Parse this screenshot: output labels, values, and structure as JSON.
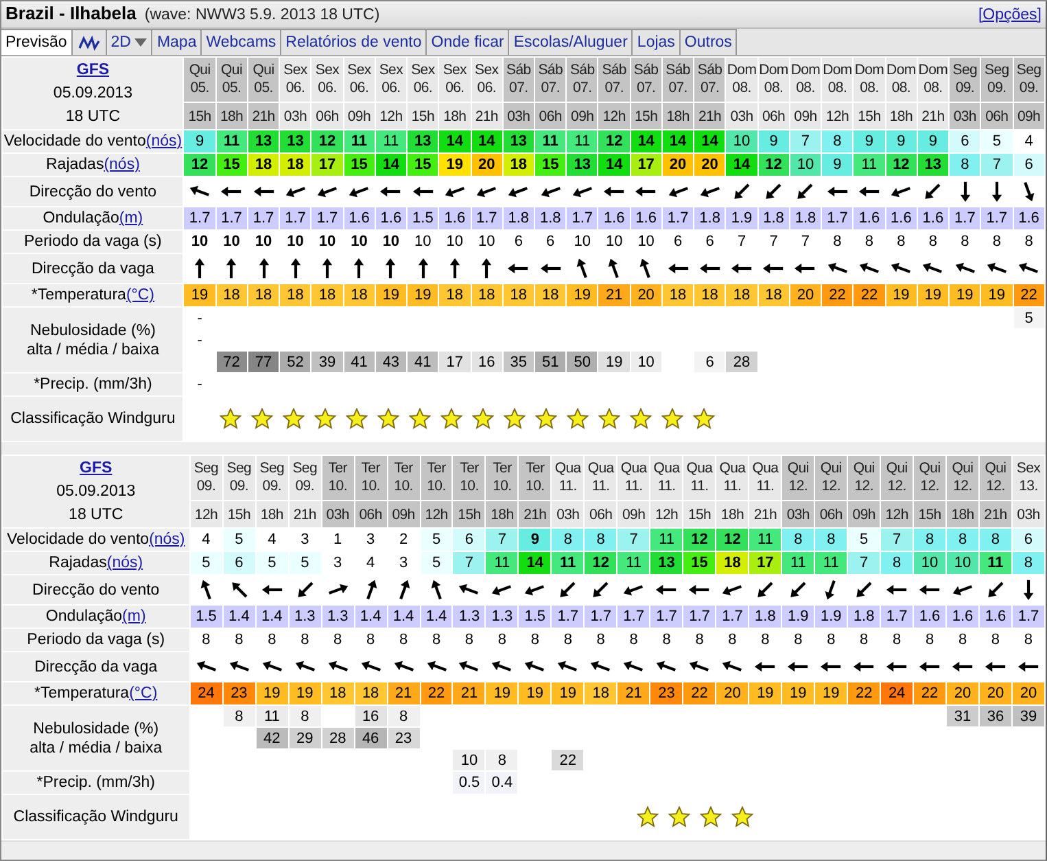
{
  "title": "Brazil - Ilhabela",
  "subtitle": "(wave: NWW3 5.9. 2013 18 UTC)",
  "options_link": "[Opções]",
  "tabs": [
    {
      "kind": "text",
      "label": "Previsão",
      "selected": true
    },
    {
      "kind": "chart",
      "selected": false
    },
    {
      "kind": "dropdown",
      "label": "2D",
      "selected": false
    },
    {
      "kind": "text",
      "label": "Mapa",
      "selected": false
    },
    {
      "kind": "text",
      "label": "Webcams",
      "selected": false
    },
    {
      "kind": "text",
      "label": "Relatórios de vento",
      "selected": false
    },
    {
      "kind": "text",
      "label": "Onde ficar",
      "selected": false
    },
    {
      "kind": "text",
      "label": "Escolas/Aluguer",
      "selected": false
    },
    {
      "kind": "text",
      "label": "Lojas",
      "selected": false
    },
    {
      "kind": "text",
      "label": "Outros",
      "selected": false
    }
  ],
  "forecasts": [
    {
      "model": "GFS",
      "date": "05.09.2013",
      "time": "18 UTC",
      "rows": [
        {
          "kind": "wind_speed",
          "label": "Velocidade do vento",
          "unit": "(nós)"
        },
        {
          "kind": "gusts",
          "label": "Rajadas",
          "unit": "(nós)"
        },
        {
          "kind": "wind_dir",
          "label": "Direcção do vento"
        },
        {
          "kind": "swell",
          "label": "Ondulação",
          "unit": "(m)"
        },
        {
          "kind": "period",
          "label": "Periodo da vaga (s)"
        },
        {
          "kind": "wave_dir",
          "label": "Direcção da vaga"
        },
        {
          "kind": "temperature",
          "label": "*Temperatura",
          "unit": "(°C)"
        },
        {
          "kind": "cloud",
          "label": "Nebulosidade (%)",
          "sublabel": "alta / média / baixa"
        },
        {
          "kind": "precip",
          "label": "*Precip. (mm/3h)"
        },
        {
          "kind": "rating",
          "label": "Classificação Windguru"
        }
      ],
      "columns": [
        {
          "day": "Qui",
          "date": "05.",
          "hour": "15h",
          "shaded": true,
          "wind_speed": {
            "value": "9",
            "bold": false
          },
          "gusts": {
            "value": "12",
            "bold": true
          },
          "wind_dir": {
            "kind": "wnw"
          },
          "swell": "1.7",
          "period": {
            "value": "10",
            "bold": true
          },
          "wave_dir": {
            "kind": "n"
          },
          "temperature": "19",
          "cloud_high": "-",
          "cloud_mid": "-",
          "precip": "-"
        },
        {
          "day": "Qui",
          "date": "05.",
          "hour": "18h",
          "shaded": true,
          "wind_speed": {
            "value": "11",
            "bold": true
          },
          "gusts": {
            "value": "15",
            "bold": true
          },
          "wind_dir": {
            "kind": "w"
          },
          "swell": "1.7",
          "period": {
            "value": "10",
            "bold": true
          },
          "wave_dir": {
            "kind": "n"
          },
          "temperature": "18",
          "cloud_low": "72",
          "rated": true
        },
        {
          "day": "Qui",
          "date": "05.",
          "hour": "21h",
          "shaded": true,
          "wind_speed": {
            "value": "13",
            "bold": true
          },
          "gusts": {
            "value": "18",
            "bold": true
          },
          "wind_dir": {
            "kind": "w"
          },
          "swell": "1.7",
          "period": {
            "value": "10",
            "bold": true
          },
          "wave_dir": {
            "kind": "n"
          },
          "temperature": "18",
          "cloud_low": "77",
          "rated": true
        },
        {
          "day": "Sex",
          "date": "06.",
          "hour": "03h",
          "shaded": false,
          "wind_speed": {
            "value": "13",
            "bold": true
          },
          "gusts": {
            "value": "18",
            "bold": true
          },
          "wind_dir": {
            "kind": "wsw"
          },
          "swell": "1.7",
          "period": {
            "value": "10",
            "bold": true
          },
          "wave_dir": {
            "kind": "n"
          },
          "temperature": "18",
          "cloud_low": "52",
          "rated": true
        },
        {
          "day": "Sex",
          "date": "06.",
          "hour": "06h",
          "shaded": false,
          "wind_speed": {
            "value": "12",
            "bold": true
          },
          "gusts": {
            "value": "17",
            "bold": true
          },
          "wind_dir": {
            "kind": "wsw"
          },
          "swell": "1.7",
          "period": {
            "value": "10",
            "bold": true
          },
          "wave_dir": {
            "kind": "n"
          },
          "temperature": "18",
          "cloud_low": "39",
          "rated": true
        },
        {
          "day": "Sex",
          "date": "06.",
          "hour": "09h",
          "shaded": false,
          "wind_speed": {
            "value": "11",
            "bold": true
          },
          "gusts": {
            "value": "15",
            "bold": true
          },
          "wind_dir": {
            "kind": "wsw"
          },
          "swell": "1.6",
          "period": {
            "value": "10",
            "bold": true
          },
          "wave_dir": {
            "kind": "n"
          },
          "temperature": "18",
          "cloud_low": "41",
          "rated": true
        },
        {
          "day": "Sex",
          "date": "06.",
          "hour": "12h",
          "shaded": false,
          "wind_speed": {
            "value": "11",
            "bold": false
          },
          "gusts": {
            "value": "14",
            "bold": true
          },
          "wind_dir": {
            "kind": "w"
          },
          "swell": "1.6",
          "period": {
            "value": "10",
            "bold": true
          },
          "wave_dir": {
            "kind": "n"
          },
          "temperature": "19",
          "cloud_low": "43",
          "rated": true
        },
        {
          "day": "Sex",
          "date": "06.",
          "hour": "15h",
          "shaded": false,
          "wind_speed": {
            "value": "13",
            "bold": true
          },
          "gusts": {
            "value": "15",
            "bold": true
          },
          "wind_dir": {
            "kind": "w"
          },
          "swell": "1.5",
          "period": {
            "value": "10",
            "bold": false
          },
          "wave_dir": {
            "kind": "n"
          },
          "temperature": "19",
          "cloud_low": "41",
          "rated": true
        },
        {
          "day": "Sex",
          "date": "06.",
          "hour": "18h",
          "shaded": false,
          "wind_speed": {
            "value": "14",
            "bold": true
          },
          "gusts": {
            "value": "19",
            "bold": true
          },
          "wind_dir": {
            "kind": "wsw"
          },
          "swell": "1.6",
          "period": {
            "value": "10",
            "bold": false
          },
          "wave_dir": {
            "kind": "n"
          },
          "temperature": "18",
          "cloud_low": "17",
          "rated": true
        },
        {
          "day": "Sex",
          "date": "06.",
          "hour": "21h",
          "shaded": false,
          "wind_speed": {
            "value": "14",
            "bold": true
          },
          "gusts": {
            "value": "20",
            "bold": true
          },
          "wind_dir": {
            "kind": "wsw"
          },
          "swell": "1.7",
          "period": {
            "value": "10",
            "bold": false
          },
          "wave_dir": {
            "kind": "n"
          },
          "temperature": "18",
          "cloud_low": "16",
          "rated": true
        },
        {
          "day": "Sáb",
          "date": "07.",
          "hour": "03h",
          "shaded": true,
          "wind_speed": {
            "value": "13",
            "bold": true
          },
          "gusts": {
            "value": "18",
            "bold": true
          },
          "wind_dir": {
            "kind": "wsw"
          },
          "swell": "1.8",
          "period": {
            "value": "6",
            "bold": false
          },
          "wave_dir": {
            "kind": "w"
          },
          "temperature": "18",
          "cloud_low": "35",
          "rated": true
        },
        {
          "day": "Sáb",
          "date": "07.",
          "hour": "06h",
          "shaded": true,
          "wind_speed": {
            "value": "11",
            "bold": true
          },
          "gusts": {
            "value": "15",
            "bold": true
          },
          "wind_dir": {
            "kind": "wsw"
          },
          "swell": "1.8",
          "period": {
            "value": "6",
            "bold": false
          },
          "wave_dir": {
            "kind": "w"
          },
          "temperature": "18",
          "cloud_low": "51",
          "rated": true
        },
        {
          "day": "Sáb",
          "date": "07.",
          "hour": "09h",
          "shaded": true,
          "wind_speed": {
            "value": "11",
            "bold": false
          },
          "gusts": {
            "value": "13",
            "bold": true
          },
          "wind_dir": {
            "kind": "wsw"
          },
          "swell": "1.7",
          "period": {
            "value": "10",
            "bold": false
          },
          "wave_dir": {
            "kind": "nnw"
          },
          "temperature": "19",
          "cloud_low": "50",
          "rated": true
        },
        {
          "day": "Sáb",
          "date": "07.",
          "hour": "12h",
          "shaded": true,
          "wind_speed": {
            "value": "12",
            "bold": true
          },
          "gusts": {
            "value": "14",
            "bold": true
          },
          "wind_dir": {
            "kind": "w"
          },
          "swell": "1.6",
          "period": {
            "value": "10",
            "bold": false
          },
          "wave_dir": {
            "kind": "nnw"
          },
          "temperature": "21",
          "cloud_low": "19",
          "rated": true
        },
        {
          "day": "Sáb",
          "date": "07.",
          "hour": "15h",
          "shaded": true,
          "wind_speed": {
            "value": "14",
            "bold": true
          },
          "gusts": {
            "value": "17",
            "bold": true
          },
          "wind_dir": {
            "kind": "w"
          },
          "swell": "1.6",
          "period": {
            "value": "10",
            "bold": false
          },
          "wave_dir": {
            "kind": "nnw"
          },
          "temperature": "20",
          "cloud_low": "10",
          "rated": true
        },
        {
          "day": "Sáb",
          "date": "07.",
          "hour": "18h",
          "shaded": true,
          "wind_speed": {
            "value": "14",
            "bold": true
          },
          "gusts": {
            "value": "20",
            "bold": true
          },
          "wind_dir": {
            "kind": "wsw"
          },
          "swell": "1.7",
          "period": {
            "value": "6",
            "bold": false
          },
          "wave_dir": {
            "kind": "w"
          },
          "temperature": "18",
          "rated": true
        },
        {
          "day": "Sáb",
          "date": "07.",
          "hour": "21h",
          "shaded": true,
          "wind_speed": {
            "value": "14",
            "bold": true
          },
          "gusts": {
            "value": "20",
            "bold": true
          },
          "wind_dir": {
            "kind": "wsw"
          },
          "swell": "1.8",
          "period": {
            "value": "6",
            "bold": false
          },
          "wave_dir": {
            "kind": "w"
          },
          "temperature": "18",
          "cloud_low": "6",
          "rated": true
        },
        {
          "day": "Dom",
          "date": "08.",
          "hour": "03h",
          "shaded": false,
          "wind_speed": {
            "value": "10",
            "bold": false
          },
          "gusts": {
            "value": "14",
            "bold": true
          },
          "wind_dir": {
            "kind": "sw"
          },
          "swell": "1.9",
          "period": {
            "value": "7",
            "bold": false
          },
          "wave_dir": {
            "kind": "w"
          },
          "temperature": "18",
          "cloud_low": "28"
        },
        {
          "day": "Dom",
          "date": "08.",
          "hour": "06h",
          "shaded": false,
          "wind_speed": {
            "value": "9",
            "bold": false
          },
          "gusts": {
            "value": "12",
            "bold": true
          },
          "wind_dir": {
            "kind": "sw"
          },
          "swell": "1.8",
          "period": {
            "value": "7",
            "bold": false
          },
          "wave_dir": {
            "kind": "w"
          },
          "temperature": "18"
        },
        {
          "day": "Dom",
          "date": "08.",
          "hour": "09h",
          "shaded": false,
          "wind_speed": {
            "value": "7",
            "bold": false
          },
          "gusts": {
            "value": "10",
            "bold": false
          },
          "wind_dir": {
            "kind": "sw"
          },
          "swell": "1.8",
          "period": {
            "value": "7",
            "bold": false
          },
          "wave_dir": {
            "kind": "w"
          },
          "temperature": "20"
        },
        {
          "day": "Dom",
          "date": "08.",
          "hour": "12h",
          "shaded": false,
          "wind_speed": {
            "value": "8",
            "bold": false
          },
          "gusts": {
            "value": "9",
            "bold": false
          },
          "wind_dir": {
            "kind": "w"
          },
          "swell": "1.7",
          "period": {
            "value": "8",
            "bold": false
          },
          "wave_dir": {
            "kind": "wnw"
          },
          "temperature": "22"
        },
        {
          "day": "Dom",
          "date": "08.",
          "hour": "15h",
          "shaded": false,
          "wind_speed": {
            "value": "9",
            "bold": false
          },
          "gusts": {
            "value": "11",
            "bold": false
          },
          "wind_dir": {
            "kind": "w"
          },
          "swell": "1.6",
          "period": {
            "value": "8",
            "bold": false
          },
          "wave_dir": {
            "kind": "wnw"
          },
          "temperature": "22"
        },
        {
          "day": "Dom",
          "date": "08.",
          "hour": "18h",
          "shaded": false,
          "wind_speed": {
            "value": "9",
            "bold": false
          },
          "gusts": {
            "value": "12",
            "bold": true
          },
          "wind_dir": {
            "kind": "wsw"
          },
          "swell": "1.6",
          "period": {
            "value": "8",
            "bold": false
          },
          "wave_dir": {
            "kind": "wnw"
          },
          "temperature": "19"
        },
        {
          "day": "Dom",
          "date": "08.",
          "hour": "21h",
          "shaded": false,
          "wind_speed": {
            "value": "9",
            "bold": false
          },
          "gusts": {
            "value": "13",
            "bold": true
          },
          "wind_dir": {
            "kind": "sw"
          },
          "swell": "1.6",
          "period": {
            "value": "8",
            "bold": false
          },
          "wave_dir": {
            "kind": "wnw"
          },
          "temperature": "19"
        },
        {
          "day": "Seg",
          "date": "09.",
          "hour": "03h",
          "shaded": true,
          "wind_speed": {
            "value": "6",
            "bold": false
          },
          "gusts": {
            "value": "8",
            "bold": false
          },
          "wind_dir": {
            "kind": "s"
          },
          "swell": "1.7",
          "period": {
            "value": "8",
            "bold": false
          },
          "wave_dir": {
            "kind": "wnw"
          },
          "temperature": "19"
        },
        {
          "day": "Seg",
          "date": "09.",
          "hour": "06h",
          "shaded": true,
          "wind_speed": {
            "value": "5",
            "bold": false
          },
          "gusts": {
            "value": "7",
            "bold": false
          },
          "wind_dir": {
            "kind": "s"
          },
          "swell": "1.7",
          "period": {
            "value": "8",
            "bold": false
          },
          "wave_dir": {
            "kind": "wnw"
          },
          "temperature": "19"
        },
        {
          "day": "Seg",
          "date": "09.",
          "hour": "09h",
          "shaded": true,
          "wind_speed": {
            "value": "4",
            "bold": false
          },
          "gusts": {
            "value": "6",
            "bold": false
          },
          "wind_dir": {
            "kind": "sse"
          },
          "swell": "1.6",
          "period": {
            "value": "8",
            "bold": false
          },
          "wave_dir": {
            "kind": "wnw"
          },
          "temperature": "22",
          "cloud_high": "5"
        }
      ]
    },
    {
      "model": "GFS",
      "date": "05.09.2013",
      "time": "18 UTC",
      "rows": [
        {
          "kind": "wind_speed",
          "label": "Velocidade do vento",
          "unit": "(nós)"
        },
        {
          "kind": "gusts",
          "label": "Rajadas",
          "unit": "(nós)"
        },
        {
          "kind": "wind_dir",
          "label": "Direcção do vento"
        },
        {
          "kind": "swell",
          "label": "Ondulação",
          "unit": "(m)"
        },
        {
          "kind": "period",
          "label": "Periodo da vaga (s)"
        },
        {
          "kind": "wave_dir",
          "label": "Direcção da vaga"
        },
        {
          "kind": "temperature",
          "label": "*Temperatura",
          "unit": "(°C)"
        },
        {
          "kind": "cloud",
          "label": "Nebulosidade (%)",
          "sublabel": "alta / média / baixa"
        },
        {
          "kind": "precip",
          "label": "*Precip. (mm/3h)"
        },
        {
          "kind": "rating",
          "label": "Classificação Windguru"
        }
      ],
      "columns": [
        {
          "day": "Seg",
          "date": "09.",
          "hour": "12h",
          "shaded": false,
          "wind_speed": {
            "value": "4",
            "bold": false
          },
          "gusts": {
            "value": "5",
            "bold": false
          },
          "wind_dir": {
            "kind": "nnw"
          },
          "swell": "1.5",
          "period": {
            "value": "8",
            "bold": false
          },
          "wave_dir": {
            "kind": "wnw"
          },
          "temperature": "24"
        },
        {
          "day": "Seg",
          "date": "09.",
          "hour": "15h",
          "shaded": false,
          "wind_speed": {
            "value": "5",
            "bold": false
          },
          "gusts": {
            "value": "6",
            "bold": false
          },
          "wind_dir": {
            "kind": "nw"
          },
          "swell": "1.4",
          "period": {
            "value": "8",
            "bold": false
          },
          "wave_dir": {
            "kind": "wnw"
          },
          "temperature": "23",
          "cloud_high": "8"
        },
        {
          "day": "Seg",
          "date": "09.",
          "hour": "18h",
          "shaded": false,
          "wind_speed": {
            "value": "4",
            "bold": false
          },
          "gusts": {
            "value": "5",
            "bold": false
          },
          "wind_dir": {
            "kind": "w"
          },
          "swell": "1.4",
          "period": {
            "value": "8",
            "bold": false
          },
          "wave_dir": {
            "kind": "wnw"
          },
          "temperature": "19",
          "cloud_high": "11",
          "cloud_mid": "42"
        },
        {
          "day": "Seg",
          "date": "09.",
          "hour": "21h",
          "shaded": false,
          "wind_speed": {
            "value": "3",
            "bold": false
          },
          "gusts": {
            "value": "5",
            "bold": false
          },
          "wind_dir": {
            "kind": "sw"
          },
          "swell": "1.3",
          "period": {
            "value": "8",
            "bold": false
          },
          "wave_dir": {
            "kind": "wnw"
          },
          "temperature": "19",
          "cloud_high": "8",
          "cloud_mid": "29"
        },
        {
          "day": "Ter",
          "date": "10.",
          "hour": "03h",
          "shaded": true,
          "wind_speed": {
            "value": "1",
            "bold": false
          },
          "gusts": {
            "value": "3",
            "bold": false
          },
          "wind_dir": {
            "kind": "ene"
          },
          "swell": "1.3",
          "period": {
            "value": "8",
            "bold": false
          },
          "wave_dir": {
            "kind": "wnw"
          },
          "temperature": "18",
          "cloud_mid": "28"
        },
        {
          "day": "Ter",
          "date": "10.",
          "hour": "06h",
          "shaded": true,
          "wind_speed": {
            "value": "3",
            "bold": false
          },
          "gusts": {
            "value": "4",
            "bold": false
          },
          "wind_dir": {
            "kind": "nne"
          },
          "swell": "1.4",
          "period": {
            "value": "8",
            "bold": false
          },
          "wave_dir": {
            "kind": "wnw"
          },
          "temperature": "18",
          "cloud_high": "16",
          "cloud_mid": "46"
        },
        {
          "day": "Ter",
          "date": "10.",
          "hour": "09h",
          "shaded": true,
          "wind_speed": {
            "value": "2",
            "bold": false
          },
          "gusts": {
            "value": "3",
            "bold": false
          },
          "wind_dir": {
            "kind": "nne"
          },
          "swell": "1.4",
          "period": {
            "value": "8",
            "bold": false
          },
          "wave_dir": {
            "kind": "wnw"
          },
          "temperature": "21",
          "cloud_high": "8",
          "cloud_mid": "23"
        },
        {
          "day": "Ter",
          "date": "10.",
          "hour": "12h",
          "shaded": true,
          "wind_speed": {
            "value": "5",
            "bold": false
          },
          "gusts": {
            "value": "5",
            "bold": false
          },
          "wind_dir": {
            "kind": "nnw"
          },
          "swell": "1.4",
          "period": {
            "value": "8",
            "bold": false
          },
          "wave_dir": {
            "kind": "wnw"
          },
          "temperature": "22"
        },
        {
          "day": "Ter",
          "date": "10.",
          "hour": "15h",
          "shaded": true,
          "wind_speed": {
            "value": "6",
            "bold": false
          },
          "gusts": {
            "value": "7",
            "bold": false
          },
          "wind_dir": {
            "kind": "wnw"
          },
          "swell": "1.3",
          "period": {
            "value": "8",
            "bold": false
          },
          "wave_dir": {
            "kind": "wnw"
          },
          "temperature": "21",
          "cloud_low": "10",
          "precip": "0.5"
        },
        {
          "day": "Ter",
          "date": "10.",
          "hour": "18h",
          "shaded": true,
          "wind_speed": {
            "value": "7",
            "bold": false
          },
          "gusts": {
            "value": "11",
            "bold": false
          },
          "wind_dir": {
            "kind": "wsw"
          },
          "swell": "1.3",
          "period": {
            "value": "8",
            "bold": false
          },
          "wave_dir": {
            "kind": "wnw"
          },
          "temperature": "19",
          "cloud_low": "8",
          "precip": "0.4"
        },
        {
          "day": "Ter",
          "date": "10.",
          "hour": "21h",
          "shaded": true,
          "wind_speed": {
            "value": "9",
            "bold": true
          },
          "gusts": {
            "value": "14",
            "bold": true
          },
          "wind_dir": {
            "kind": "wsw"
          },
          "swell": "1.5",
          "period": {
            "value": "8",
            "bold": false
          },
          "wave_dir": {
            "kind": "wnw"
          },
          "temperature": "19"
        },
        {
          "day": "Qua",
          "date": "11.",
          "hour": "03h",
          "shaded": false,
          "wind_speed": {
            "value": "8",
            "bold": false
          },
          "gusts": {
            "value": "11",
            "bold": true
          },
          "wind_dir": {
            "kind": "sw"
          },
          "swell": "1.7",
          "period": {
            "value": "8",
            "bold": false
          },
          "wave_dir": {
            "kind": "wnw"
          },
          "temperature": "19",
          "cloud_low": "22"
        },
        {
          "day": "Qua",
          "date": "11.",
          "hour": "06h",
          "shaded": false,
          "wind_speed": {
            "value": "8",
            "bold": false
          },
          "gusts": {
            "value": "12",
            "bold": true
          },
          "wind_dir": {
            "kind": "sw"
          },
          "swell": "1.7",
          "period": {
            "value": "8",
            "bold": false
          },
          "wave_dir": {
            "kind": "wnw"
          },
          "temperature": "18"
        },
        {
          "day": "Qua",
          "date": "11.",
          "hour": "09h",
          "shaded": false,
          "wind_speed": {
            "value": "7",
            "bold": false
          },
          "gusts": {
            "value": "11",
            "bold": false
          },
          "wind_dir": {
            "kind": "wsw"
          },
          "swell": "1.7",
          "period": {
            "value": "8",
            "bold": false
          },
          "wave_dir": {
            "kind": "wnw"
          },
          "temperature": "21"
        },
        {
          "day": "Qua",
          "date": "11.",
          "hour": "12h",
          "shaded": false,
          "wind_speed": {
            "value": "11",
            "bold": false
          },
          "gusts": {
            "value": "13",
            "bold": true
          },
          "wind_dir": {
            "kind": "w"
          },
          "swell": "1.7",
          "period": {
            "value": "8",
            "bold": false
          },
          "wave_dir": {
            "kind": "wnw"
          },
          "temperature": "23",
          "rated": true
        },
        {
          "day": "Qua",
          "date": "11.",
          "hour": "15h",
          "shaded": false,
          "wind_speed": {
            "value": "12",
            "bold": true
          },
          "gusts": {
            "value": "15",
            "bold": true
          },
          "wind_dir": {
            "kind": "w"
          },
          "swell": "1.7",
          "period": {
            "value": "8",
            "bold": false
          },
          "wave_dir": {
            "kind": "wnw"
          },
          "temperature": "22",
          "rated": true
        },
        {
          "day": "Qua",
          "date": "11.",
          "hour": "18h",
          "shaded": false,
          "wind_speed": {
            "value": "12",
            "bold": true
          },
          "gusts": {
            "value": "18",
            "bold": true
          },
          "wind_dir": {
            "kind": "wsw"
          },
          "swell": "1.7",
          "period": {
            "value": "8",
            "bold": false
          },
          "wave_dir": {
            "kind": "wnw"
          },
          "temperature": "20",
          "rated": true
        },
        {
          "day": "Qua",
          "date": "11.",
          "hour": "21h",
          "shaded": false,
          "wind_speed": {
            "value": "11",
            "bold": false
          },
          "gusts": {
            "value": "17",
            "bold": true
          },
          "wind_dir": {
            "kind": "sw"
          },
          "swell": "1.8",
          "period": {
            "value": "8",
            "bold": false
          },
          "wave_dir": {
            "kind": "w"
          },
          "temperature": "19",
          "rated": true
        },
        {
          "day": "Qui",
          "date": "12.",
          "hour": "03h",
          "shaded": true,
          "wind_speed": {
            "value": "8",
            "bold": false
          },
          "gusts": {
            "value": "11",
            "bold": false
          },
          "wind_dir": {
            "kind": "sw"
          },
          "swell": "1.9",
          "period": {
            "value": "8",
            "bold": false
          },
          "wave_dir": {
            "kind": "w"
          },
          "temperature": "19"
        },
        {
          "day": "Qui",
          "date": "12.",
          "hour": "06h",
          "shaded": true,
          "wind_speed": {
            "value": "8",
            "bold": false
          },
          "gusts": {
            "value": "11",
            "bold": false
          },
          "wind_dir": {
            "kind": "ssw"
          },
          "swell": "1.9",
          "period": {
            "value": "8",
            "bold": false
          },
          "wave_dir": {
            "kind": "w"
          },
          "temperature": "19"
        },
        {
          "day": "Qui",
          "date": "12.",
          "hour": "09h",
          "shaded": true,
          "wind_speed": {
            "value": "5",
            "bold": false
          },
          "gusts": {
            "value": "7",
            "bold": false
          },
          "wind_dir": {
            "kind": "sw"
          },
          "swell": "1.8",
          "period": {
            "value": "8",
            "bold": false
          },
          "wave_dir": {
            "kind": "w"
          },
          "temperature": "22"
        },
        {
          "day": "Qui",
          "date": "12.",
          "hour": "12h",
          "shaded": true,
          "wind_speed": {
            "value": "7",
            "bold": false
          },
          "gusts": {
            "value": "8",
            "bold": false
          },
          "wind_dir": {
            "kind": "w"
          },
          "swell": "1.7",
          "period": {
            "value": "8",
            "bold": false
          },
          "wave_dir": {
            "kind": "w"
          },
          "temperature": "24"
        },
        {
          "day": "Qui",
          "date": "12.",
          "hour": "15h",
          "shaded": true,
          "wind_speed": {
            "value": "8",
            "bold": false
          },
          "gusts": {
            "value": "10",
            "bold": false
          },
          "wind_dir": {
            "kind": "w"
          },
          "swell": "1.6",
          "period": {
            "value": "8",
            "bold": false
          },
          "wave_dir": {
            "kind": "w"
          },
          "temperature": "22"
        },
        {
          "day": "Qui",
          "date": "12.",
          "hour": "18h",
          "shaded": true,
          "wind_speed": {
            "value": "8",
            "bold": false
          },
          "gusts": {
            "value": "10",
            "bold": false
          },
          "wind_dir": {
            "kind": "wsw"
          },
          "swell": "1.6",
          "period": {
            "value": "8",
            "bold": false
          },
          "wave_dir": {
            "kind": "w"
          },
          "temperature": "20",
          "cloud_high": "31"
        },
        {
          "day": "Qui",
          "date": "12.",
          "hour": "21h",
          "shaded": true,
          "wind_speed": {
            "value": "8",
            "bold": false
          },
          "gusts": {
            "value": "11",
            "bold": true
          },
          "wind_dir": {
            "kind": "sw"
          },
          "swell": "1.6",
          "period": {
            "value": "8",
            "bold": false
          },
          "wave_dir": {
            "kind": "w"
          },
          "temperature": "20",
          "cloud_high": "36"
        },
        {
          "day": "Sex",
          "date": "13.",
          "hour": "03h",
          "shaded": false,
          "wind_speed": {
            "value": "6",
            "bold": false
          },
          "gusts": {
            "value": "8",
            "bold": false
          },
          "wind_dir": {
            "kind": "s"
          },
          "swell": "1.7",
          "period": {
            "value": "8",
            "bold": false
          },
          "wave_dir": {
            "kind": "w"
          },
          "temperature": "20",
          "cloud_high": "39"
        }
      ]
    }
  ]
}
